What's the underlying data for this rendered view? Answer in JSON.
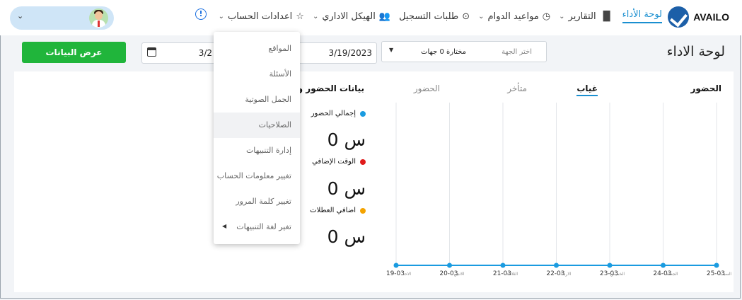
{
  "brand": {
    "name": "AVAILO"
  },
  "nav": {
    "items": [
      {
        "label": "لوحة الأداء",
        "active": true,
        "icon": ""
      },
      {
        "label": "التقارير",
        "icon": "bar-chart-icon"
      },
      {
        "label": "مواعيد الدوام",
        "icon": "clock-icon"
      },
      {
        "label": "طلبات التسجيل",
        "icon": "play-circle-icon"
      },
      {
        "label": "الهيكل الاداري",
        "icon": "people-icon"
      },
      {
        "label": "اعدادات الحساب",
        "icon": "star-icon"
      }
    ]
  },
  "page": {
    "title": "لوحة الاداء"
  },
  "filters": {
    "entity_placeholder": "اختر الجهة",
    "entity_value": "مختارة 0 جهات",
    "end_date": "3/19/2023",
    "start_date": "3/2",
    "show_button": "عرض البيانات"
  },
  "tabs": {
    "attendance_main": "الحضور",
    "absence": "غياب",
    "late": "متأخر",
    "presence": "الحضور"
  },
  "stats": {
    "title": "بيانات الحضور والا",
    "items": [
      {
        "label": "إجمالي الحضور",
        "value": "",
        "color": "#1a9be0"
      },
      {
        "label": "الوقت الإضافي",
        "value": "0 س",
        "color": "#e01b1b"
      },
      {
        "label": "اضافي العطلات",
        "value": "0 س",
        "color": "#f4a300"
      }
    ],
    "first_value": "0 س"
  },
  "chart_data": {
    "type": "line",
    "x_dates": [
      "25-03",
      "24-03",
      "23-03",
      "22-03",
      "21-03",
      "20-03",
      "19-03"
    ],
    "x_days": [
      "السبت",
      "الجمعة",
      "الخميس",
      "الاربعاء",
      "الثلاثاء",
      "الاثنين",
      "الاحد"
    ],
    "series": [
      {
        "values": [
          0,
          0,
          0,
          0,
          0,
          0,
          0
        ],
        "color": "#1a9be0"
      }
    ],
    "grid": true
  },
  "dropdown": {
    "items": [
      {
        "label": "المواقع"
      },
      {
        "label": "الأسئلة"
      },
      {
        "label": "الجمل الصوتية"
      },
      {
        "label": "الصلاحيات"
      },
      {
        "label": "إدارة التنبيهات"
      },
      {
        "label": "تغيير معلومات الحساب"
      },
      {
        "label": "تغيير كلمة المرور"
      },
      {
        "label": "تغير لغة التنبيهات"
      }
    ]
  }
}
